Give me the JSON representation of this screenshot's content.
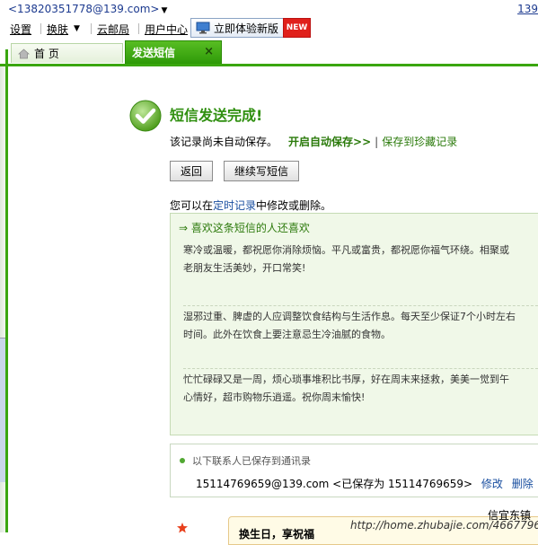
{
  "header": {
    "email": "<13820351778@139.com>",
    "top_right": "139"
  },
  "menu": {
    "settings": "设置",
    "skin": "换肤",
    "cloud_post": "云邮局",
    "user_center": "用户中心"
  },
  "new_version": {
    "label": "立即体验新版",
    "badge": "NEW"
  },
  "tabs": {
    "home": "首 页",
    "sms": "发送短信",
    "close": "×"
  },
  "result": {
    "title": "短信发送完成!",
    "note": "该记录尚未自动保存。",
    "auto_save": "开启自动保存>>",
    "separator": "|",
    "save_favorite": "保存到珍藏记录"
  },
  "buttons": {
    "back": "返回",
    "continue": "继续写短信"
  },
  "edit_note": {
    "pre": "您可以在",
    "link": "定时记录",
    "post": "中修改或删除。"
  },
  "recommendations": {
    "heading": "⇒ 喜欢这条短信的人还喜欢",
    "messages": [
      {
        "line1": "寒冷或温暖，都祝愿你消除烦恼。平凡或富贵，都祝愿你福气环绕。相聚或",
        "line2": "老朋友生活美妙，开口常笑!"
      },
      {
        "line1": "湿邪过重、脾虚的人应调整饮食结构与生活作息。每天至少保证7个小时左右",
        "line2": "时间。此外在饮食上要注意忌生冷油腻的食物。"
      },
      {
        "line1": "忙忙碌碌又是一周，烦心琐事堆积比书厚，好在周末来拯救，美美一觉到午",
        "line2": "心情好，超市购物乐逍遥。祝你周末愉快!"
      }
    ]
  },
  "contacts": {
    "heading": "以下联系人已保存到通讯录",
    "entry": "15114769659@139.com <已保存为 15114769659>",
    "edit": "修改",
    "delete": "删除"
  },
  "bottom": {
    "card_text": "换生日，享祝福",
    "right_text": "信宜东镇",
    "watermark": "http://home.zhubajie.com/4667796/"
  }
}
